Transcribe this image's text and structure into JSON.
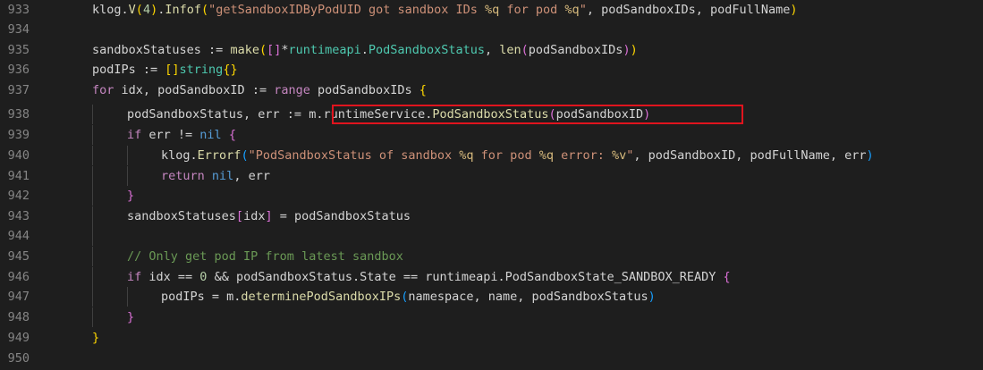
{
  "editor": {
    "accent_colors": {
      "highlight_box": "#e0141e",
      "keyword": "#569cd6",
      "function": "#dcdcaa",
      "string": "#ce9178",
      "comment": "#6a9955",
      "type": "#4ec9b0"
    },
    "lines": [
      {
        "number": "933",
        "tokens": [
          {
            "t": "klog",
            "c": "pl"
          },
          {
            "t": ".",
            "c": "pl"
          },
          {
            "t": "V",
            "c": "fn"
          },
          {
            "t": "(",
            "c": "br1"
          },
          {
            "t": "4",
            "c": "nm"
          },
          {
            "t": ")",
            "c": "br1"
          },
          {
            "t": ".",
            "c": "pl"
          },
          {
            "t": "Infof",
            "c": "fn"
          },
          {
            "t": "(",
            "c": "br1"
          },
          {
            "t": "\"getSandboxIDByPodUID got sandbox IDs ",
            "c": "st"
          },
          {
            "t": "%q",
            "c": "es"
          },
          {
            "t": " for pod ",
            "c": "st"
          },
          {
            "t": "%q",
            "c": "es"
          },
          {
            "t": "\"",
            "c": "st"
          },
          {
            "t": ", podSandboxIDs, podFullName",
            "c": "pl"
          },
          {
            "t": ")",
            "c": "br1"
          }
        ]
      },
      {
        "number": "934",
        "tokens": []
      },
      {
        "number": "935",
        "tokens": [
          {
            "t": "sandboxStatuses := ",
            "c": "pl"
          },
          {
            "t": "make",
            "c": "fn"
          },
          {
            "t": "(",
            "c": "br1"
          },
          {
            "t": "[]",
            "c": "br2"
          },
          {
            "t": "*",
            "c": "pl"
          },
          {
            "t": "runtimeapi",
            "c": "ty"
          },
          {
            "t": ".",
            "c": "pl"
          },
          {
            "t": "PodSandboxStatus",
            "c": "ty"
          },
          {
            "t": ", ",
            "c": "pl"
          },
          {
            "t": "len",
            "c": "fn"
          },
          {
            "t": "(",
            "c": "br2"
          },
          {
            "t": "podSandboxIDs",
            "c": "pl"
          },
          {
            "t": ")",
            "c": "br2"
          },
          {
            "t": ")",
            "c": "br1"
          }
        ]
      },
      {
        "number": "936",
        "tokens": [
          {
            "t": "podIPs := ",
            "c": "pl"
          },
          {
            "t": "[]",
            "c": "br1"
          },
          {
            "t": "string",
            "c": "ty"
          },
          {
            "t": "{}",
            "c": "br1"
          }
        ]
      },
      {
        "number": "937",
        "tokens": [
          {
            "t": "for",
            "c": "ct"
          },
          {
            "t": " idx, podSandboxID := ",
            "c": "pl"
          },
          {
            "t": "range",
            "c": "ct"
          },
          {
            "t": " podSandboxIDs ",
            "c": "pl"
          },
          {
            "t": "{",
            "c": "br1"
          }
        ]
      },
      {
        "number": "938",
        "tokens": [
          {
            "t": "podSandboxStatus, err := ",
            "c": "pl"
          },
          {
            "t": "m",
            "c": "pl"
          },
          {
            "t": ".",
            "c": "pl"
          },
          {
            "t": "runtimeService",
            "c": "pl"
          },
          {
            "t": ".",
            "c": "pl"
          },
          {
            "t": "PodSandboxStatus",
            "c": "fn"
          },
          {
            "t": "(",
            "c": "br2"
          },
          {
            "t": "podSandboxID",
            "c": "pl"
          },
          {
            "t": ")",
            "c": "br2"
          }
        ]
      },
      {
        "number": "939",
        "tokens": [
          {
            "t": "if",
            "c": "ct"
          },
          {
            "t": " err != ",
            "c": "pl"
          },
          {
            "t": "nil",
            "c": "kw"
          },
          {
            "t": " ",
            "c": "pl"
          },
          {
            "t": "{",
            "c": "br2"
          }
        ]
      },
      {
        "number": "940",
        "tokens": [
          {
            "t": "klog",
            "c": "pl"
          },
          {
            "t": ".",
            "c": "pl"
          },
          {
            "t": "Errorf",
            "c": "fn"
          },
          {
            "t": "(",
            "c": "br3"
          },
          {
            "t": "\"PodSandboxStatus of sandbox ",
            "c": "st"
          },
          {
            "t": "%q",
            "c": "es"
          },
          {
            "t": " for pod ",
            "c": "st"
          },
          {
            "t": "%q",
            "c": "es"
          },
          {
            "t": " error: ",
            "c": "st"
          },
          {
            "t": "%v",
            "c": "es"
          },
          {
            "t": "\"",
            "c": "st"
          },
          {
            "t": ", podSandboxID, podFullName, err",
            "c": "pl"
          },
          {
            "t": ")",
            "c": "br3"
          }
        ]
      },
      {
        "number": "941",
        "tokens": [
          {
            "t": "return",
            "c": "ct"
          },
          {
            "t": " ",
            "c": "pl"
          },
          {
            "t": "nil",
            "c": "kw"
          },
          {
            "t": ", err",
            "c": "pl"
          }
        ]
      },
      {
        "number": "942",
        "tokens": [
          {
            "t": "}",
            "c": "br2"
          }
        ]
      },
      {
        "number": "943",
        "tokens": [
          {
            "t": "sandboxStatuses",
            "c": "pl"
          },
          {
            "t": "[",
            "c": "br2"
          },
          {
            "t": "idx",
            "c": "pl"
          },
          {
            "t": "]",
            "c": "br2"
          },
          {
            "t": " = podSandboxStatus",
            "c": "pl"
          }
        ]
      },
      {
        "number": "944",
        "tokens": []
      },
      {
        "number": "945",
        "tokens": [
          {
            "t": "// Only get pod IP from latest sandbox",
            "c": "cm"
          }
        ]
      },
      {
        "number": "946",
        "tokens": [
          {
            "t": "if",
            "c": "ct"
          },
          {
            "t": " idx == ",
            "c": "pl"
          },
          {
            "t": "0",
            "c": "nm"
          },
          {
            "t": " && podSandboxStatus.State == runtimeapi.PodSandboxState_SANDBOX_READY ",
            "c": "pl"
          },
          {
            "t": "{",
            "c": "br2"
          }
        ]
      },
      {
        "number": "947",
        "tokens": [
          {
            "t": "podIPs = m.",
            "c": "pl"
          },
          {
            "t": "determinePodSandboxIPs",
            "c": "fn"
          },
          {
            "t": "(",
            "c": "br3"
          },
          {
            "t": "namespace, name, podSandboxStatus",
            "c": "pl"
          },
          {
            "t": ")",
            "c": "br3"
          }
        ]
      },
      {
        "number": "948",
        "tokens": [
          {
            "t": "}",
            "c": "br2"
          }
        ]
      },
      {
        "number": "949",
        "tokens": [
          {
            "t": "}",
            "c": "br1"
          }
        ]
      },
      {
        "number": "950",
        "tokens": []
      }
    ]
  }
}
